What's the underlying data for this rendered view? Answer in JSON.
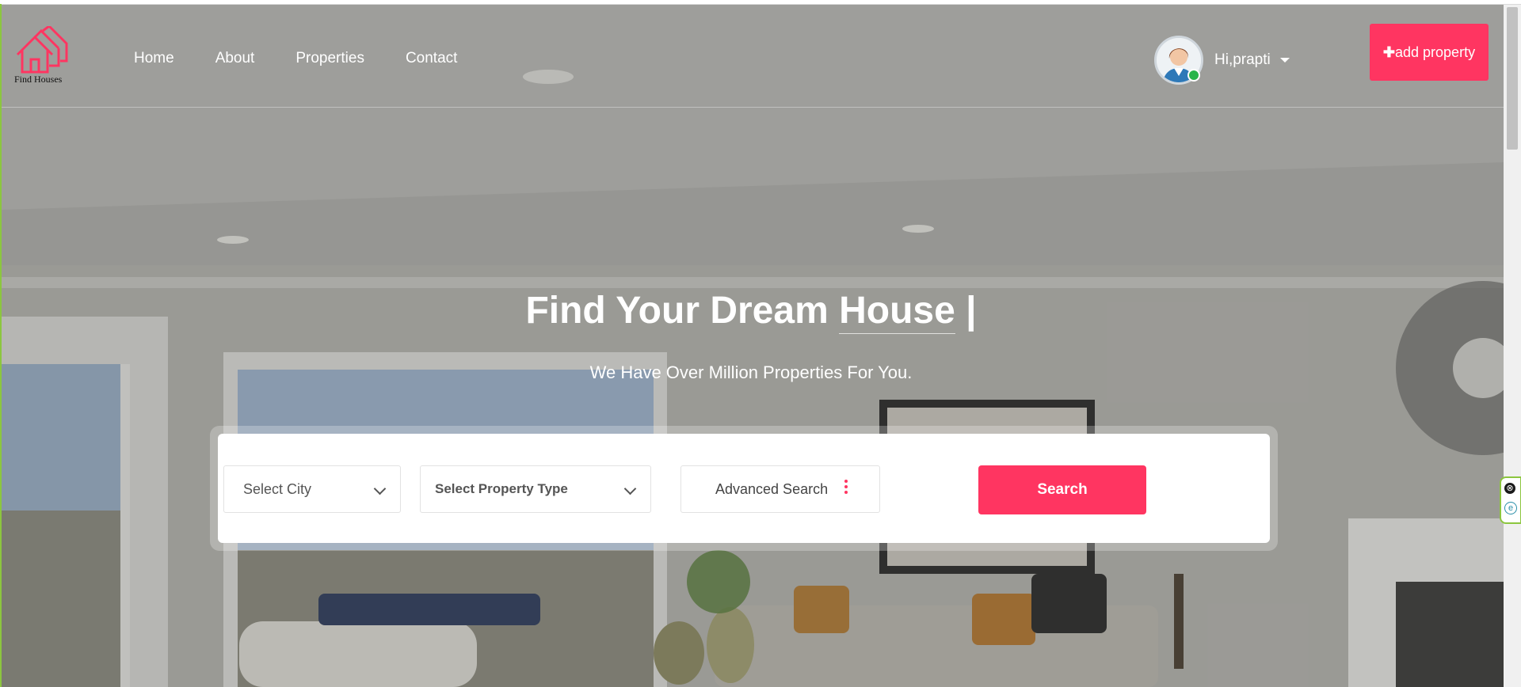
{
  "logo": {
    "text": "Find Houses",
    "icon": "house-icon"
  },
  "nav": {
    "items": [
      "Home",
      "About",
      "Properties",
      "Contact"
    ]
  },
  "user": {
    "greeting": "Hi,prapti",
    "status": "online",
    "icon": "caret-down-icon"
  },
  "actions": {
    "add_property_plus": "✚",
    "add_property_label": "add property"
  },
  "hero": {
    "headline_prefix": "Find Your Dream ",
    "headline_typed": "House",
    "headline_cursor": " |",
    "subline": "We Have Over Million Properties For You."
  },
  "search": {
    "city_placeholder": "Select City",
    "type_placeholder": "Select Property Type",
    "advanced_label": "Advanced Search",
    "button_label": "Search"
  },
  "colors": {
    "accent": "#ff3561",
    "online": "#28b44a",
    "widget_border": "#8cc63f"
  },
  "widget": {
    "close_glyph": "⊗",
    "e_glyph": "e"
  }
}
